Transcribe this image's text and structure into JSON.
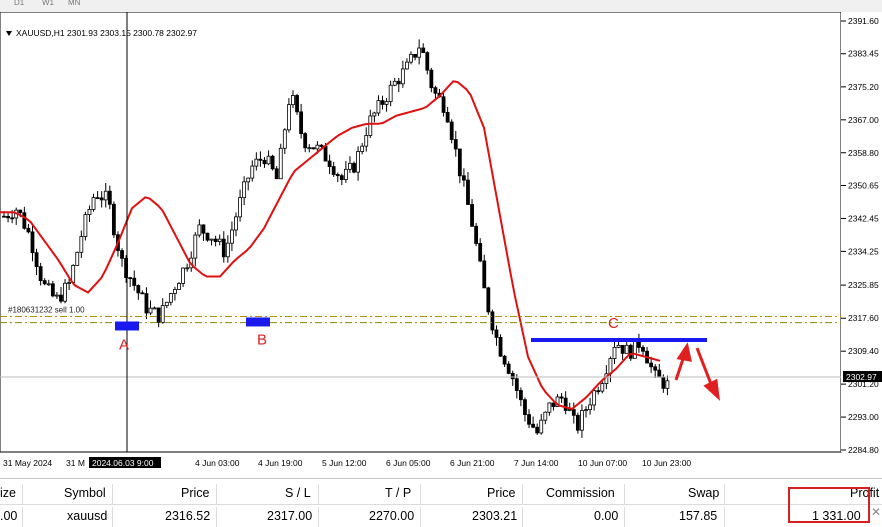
{
  "toolbar": {
    "timeframes": [
      "D1",
      "W1",
      "MN"
    ]
  },
  "symbol_info": "XAUUSD,H1  2301.93 2303.15 2300.78 2302.97",
  "order_line_label": "#180631232 sell 1.00",
  "crosshair_time_label": "2024.06.03 9:00",
  "current_price_label": "2302.97",
  "colors": {
    "up_candle": "#000000",
    "down_candle": "#000000",
    "ma_line": "#e01010",
    "zone": "#1a1aee",
    "annotation": "#e02020",
    "order_line": "#8a8a00",
    "profit_box": "#d81e1e"
  },
  "chart_data": {
    "type": "candlestick",
    "symbol": "XAUUSD",
    "timeframe": "H1",
    "ohlc_header": {
      "open": 2301.93,
      "high": 2303.15,
      "low": 2300.78,
      "close": 2302.97
    },
    "y_ticks": [
      "2391.60",
      "2383.45",
      "2375.20",
      "2367.00",
      "2358.80",
      "2350.65",
      "2342.45",
      "2334.25",
      "2325.85",
      "2317.60",
      "2309.40",
      "2301.20",
      "2293.00",
      "2284.80"
    ],
    "ylim": [
      2283,
      2393
    ],
    "x_ticks": [
      "31 May 2024",
      "31 M",
      "",
      ":00",
      "4 Jun 03:00",
      "4 Jun 19:00",
      "5 Jun 12:00",
      "6 Jun 05:00",
      "6 Jun 21:00",
      "7 Jun 14:00",
      "10 Jun 07:00",
      "10 Jun 23:00"
    ],
    "key_prices": [
      2343,
      2345,
      2338,
      2326,
      2322,
      2326,
      2339,
      2349,
      2347,
      2332,
      2326,
      2320,
      2318,
      2325,
      2331,
      2340,
      2338,
      2334,
      2345,
      2355,
      2358,
      2352,
      2374,
      2362,
      2360,
      2357,
      2352,
      2356,
      2366,
      2371,
      2376,
      2380,
      2386,
      2374,
      2370,
      2355,
      2341,
      2323,
      2311,
      2304,
      2294,
      2289,
      2296,
      2298,
      2290,
      2297,
      2303,
      2312,
      2309,
      2312,
      2303,
      2301
    ],
    "moving_average": [
      2344,
      2344,
      2342,
      2337,
      2332,
      2326,
      2324,
      2328,
      2336,
      2345,
      2348,
      2345,
      2338,
      2331,
      2328,
      2328,
      2332,
      2335,
      2340,
      2347,
      2354,
      2357,
      2360,
      2363,
      2365,
      2366,
      2366,
      2368,
      2369,
      2370,
      2373,
      2377,
      2374,
      2365,
      2345,
      2325,
      2308,
      2300,
      2296,
      2295,
      2298,
      2302,
      2305,
      2309,
      2308,
      2307
    ],
    "crosshair_price": 2302.97,
    "order_price": 2316.52,
    "zones": [
      {
        "label": "A",
        "price": 2315.8
      },
      {
        "label": "B",
        "price": 2316.8
      },
      {
        "label": "C",
        "price": 2312.2
      }
    ]
  },
  "positions": {
    "headers": [
      "ize",
      "Symbol",
      "Price",
      "S / L",
      "T / P",
      "Price",
      "Commission",
      "Swap",
      "Profit"
    ],
    "row": [
      ".00",
      "xauusd",
      "2316.52",
      "2317.00",
      "2270.00",
      "2303.21",
      "0.00",
      "157.85",
      "1 331.00"
    ]
  }
}
